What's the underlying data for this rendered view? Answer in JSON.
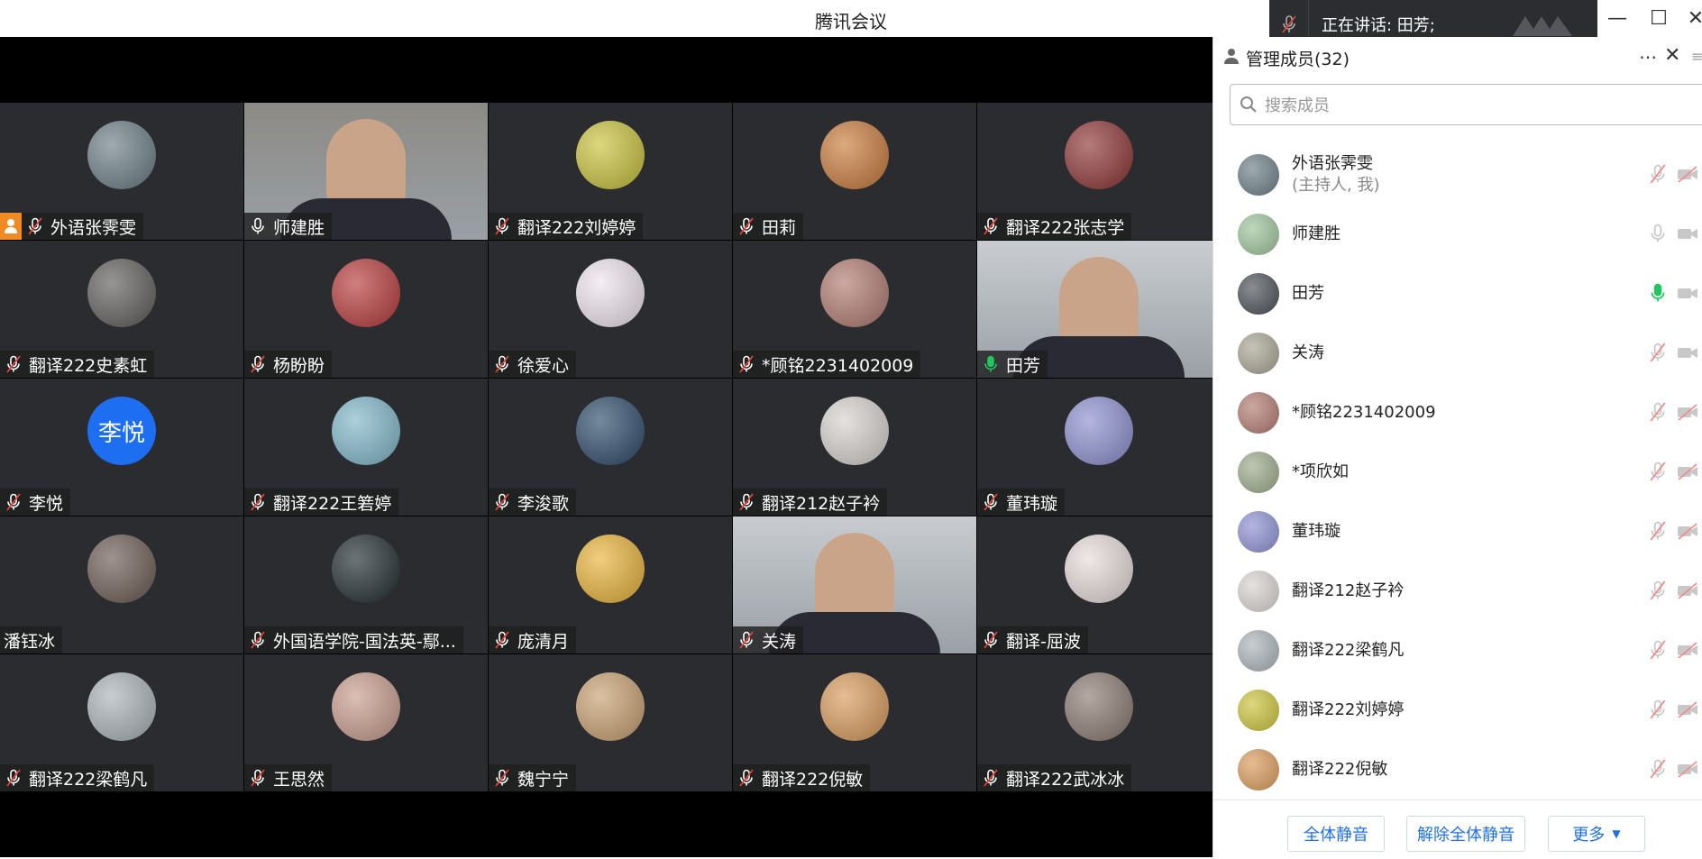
{
  "window": {
    "title": "腾讯会议"
  },
  "toast": {
    "speaking": "正在讲话: 田芳;"
  },
  "tiles": [
    {
      "name": "外语张霁雯",
      "mic": "muted",
      "host": true,
      "color": "#6b7d86"
    },
    {
      "name": "师建胜",
      "mic": "on",
      "video": true,
      "color": "#8c8a84"
    },
    {
      "name": "翻译222刘婷婷",
      "mic": "muted",
      "color": "#c9c23a"
    },
    {
      "name": "田莉",
      "mic": "muted",
      "color": "#c97a3a"
    },
    {
      "name": "翻译222张志学",
      "mic": "muted",
      "color": "#8e3434"
    },
    {
      "name": "翻译222史素虹",
      "mic": "muted",
      "color": "#5f5d5a"
    },
    {
      "name": "杨盼盼",
      "mic": "muted",
      "color": "#b83a3a"
    },
    {
      "name": "徐爱心",
      "mic": "muted",
      "color": "#efe6ef"
    },
    {
      "name": "*顾铭2231402009",
      "mic": "muted",
      "color": "#b07a70"
    },
    {
      "name": "田芳",
      "mic": "active",
      "video": true,
      "color": "#c9cdd1"
    },
    {
      "name": "李悦",
      "mic": "muted",
      "initials": "李悦",
      "color": "#1e6ef2"
    },
    {
      "name": "翻译222王箬婷",
      "mic": "muted",
      "color": "#7fb7c9"
    },
    {
      "name": "李浚歌",
      "mic": "muted",
      "color": "#2c4a6a"
    },
    {
      "name": "翻译212赵子衿",
      "mic": "muted",
      "color": "#d8d2cf"
    },
    {
      "name": "董玮璇",
      "mic": "muted",
      "color": "#8c8fd0"
    },
    {
      "name": "潘钰冰",
      "mic": "none",
      "color": "#6a5a52"
    },
    {
      "name": "外国语学院-国法英-鄢...",
      "mic": "muted",
      "color": "#1f2a30"
    },
    {
      "name": "庞清月",
      "mic": "muted",
      "color": "#e9b338"
    },
    {
      "name": "关涛",
      "mic": "muted",
      "video": true,
      "color": "#c8ccd0"
    },
    {
      "name": "翻译-屈波",
      "mic": "muted",
      "color": "#e7dcd9"
    },
    {
      "name": "翻译222梁鹤凡",
      "mic": "muted",
      "color": "#a9b2b8"
    },
    {
      "name": "王思然",
      "mic": "muted",
      "color": "#c89c8c"
    },
    {
      "name": "魏宁宁",
      "mic": "muted",
      "color": "#c8a070"
    },
    {
      "name": "翻译222倪敏",
      "mic": "muted",
      "color": "#d89a5a"
    },
    {
      "name": "翻译222武冰冰",
      "mic": "muted",
      "color": "#8a7a70"
    }
  ],
  "panel": {
    "title": "管理成员(32)",
    "search_placeholder": "搜索成员",
    "members": [
      {
        "name": "外语张霁雯",
        "sub": "(主持人, 我)",
        "mic": "muted",
        "cam": "off",
        "color": "#6b7d86"
      },
      {
        "name": "师建胜",
        "sub": "",
        "mic": "idle",
        "cam": "idle",
        "color": "#9cc29a"
      },
      {
        "name": "田芳",
        "sub": "",
        "mic": "active",
        "cam": "idle",
        "color": "#4a4f55"
      },
      {
        "name": "关涛",
        "sub": "",
        "mic": "muted",
        "cam": "idle",
        "color": "#a7a392"
      },
      {
        "name": "*顾铭2231402009",
        "sub": "",
        "mic": "muted",
        "cam": "off",
        "color": "#b07a70"
      },
      {
        "name": "*项欣如",
        "sub": "",
        "mic": "muted",
        "cam": "off",
        "color": "#9aa98a"
      },
      {
        "name": "董玮璇",
        "sub": "",
        "mic": "muted",
        "cam": "off",
        "color": "#8c8fd0"
      },
      {
        "name": "翻译212赵子衿",
        "sub": "",
        "mic": "muted",
        "cam": "off",
        "color": "#d8d2cf"
      },
      {
        "name": "翻译222梁鹤凡",
        "sub": "",
        "mic": "muted",
        "cam": "off",
        "color": "#a9b2b8"
      },
      {
        "name": "翻译222刘婷婷",
        "sub": "",
        "mic": "muted",
        "cam": "off",
        "color": "#c9c23a"
      },
      {
        "name": "翻译222倪敏",
        "sub": "",
        "mic": "muted",
        "cam": "off",
        "color": "#d89a5a"
      }
    ],
    "buttons": {
      "mute_all": "全体静音",
      "unmute_all": "解除全体静音",
      "more": "更多"
    }
  }
}
